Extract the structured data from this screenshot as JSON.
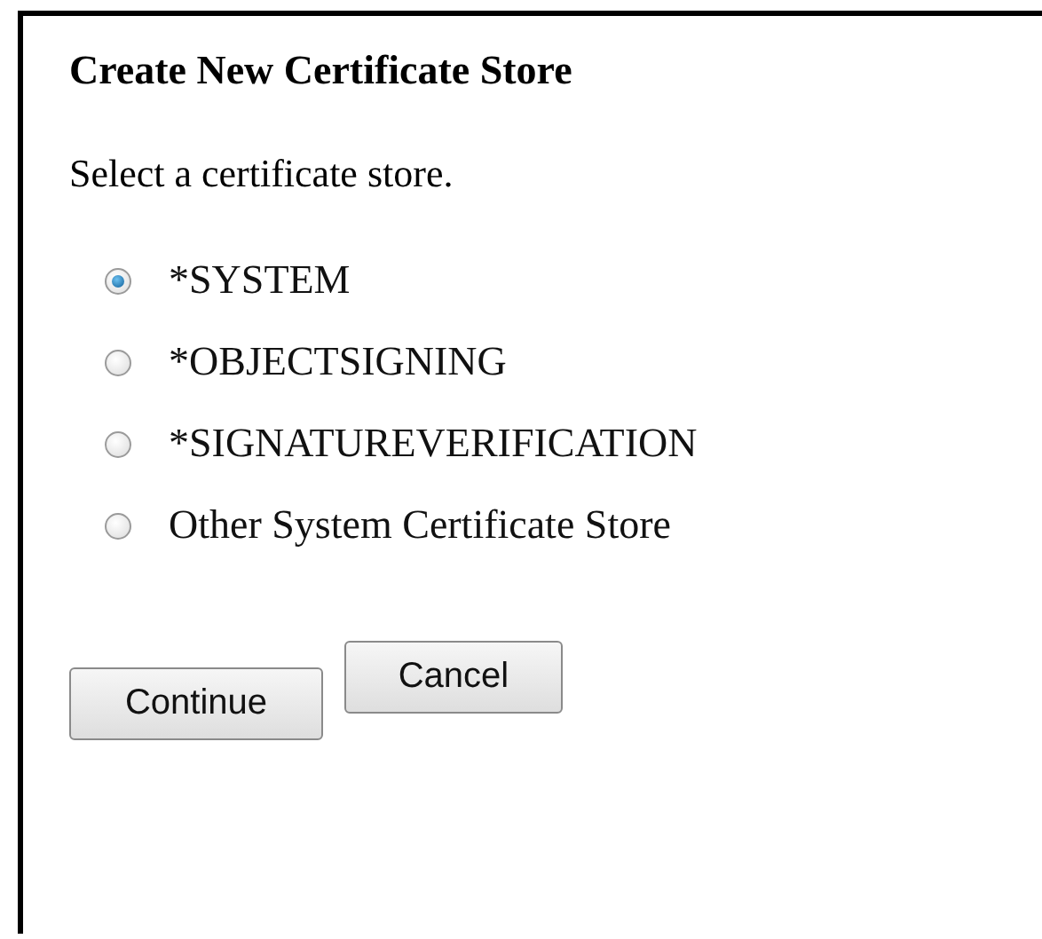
{
  "dialog": {
    "title": "Create New Certificate Store",
    "instruction": "Select a certificate store.",
    "options": [
      {
        "label": "*SYSTEM",
        "selected": true
      },
      {
        "label": "*OBJECTSIGNING",
        "selected": false
      },
      {
        "label": "*SIGNATUREVERIFICATION",
        "selected": false
      },
      {
        "label": "Other System Certificate Store",
        "selected": false
      }
    ],
    "buttons": [
      {
        "label": "Continue"
      },
      {
        "label": "Cancel"
      }
    ]
  }
}
